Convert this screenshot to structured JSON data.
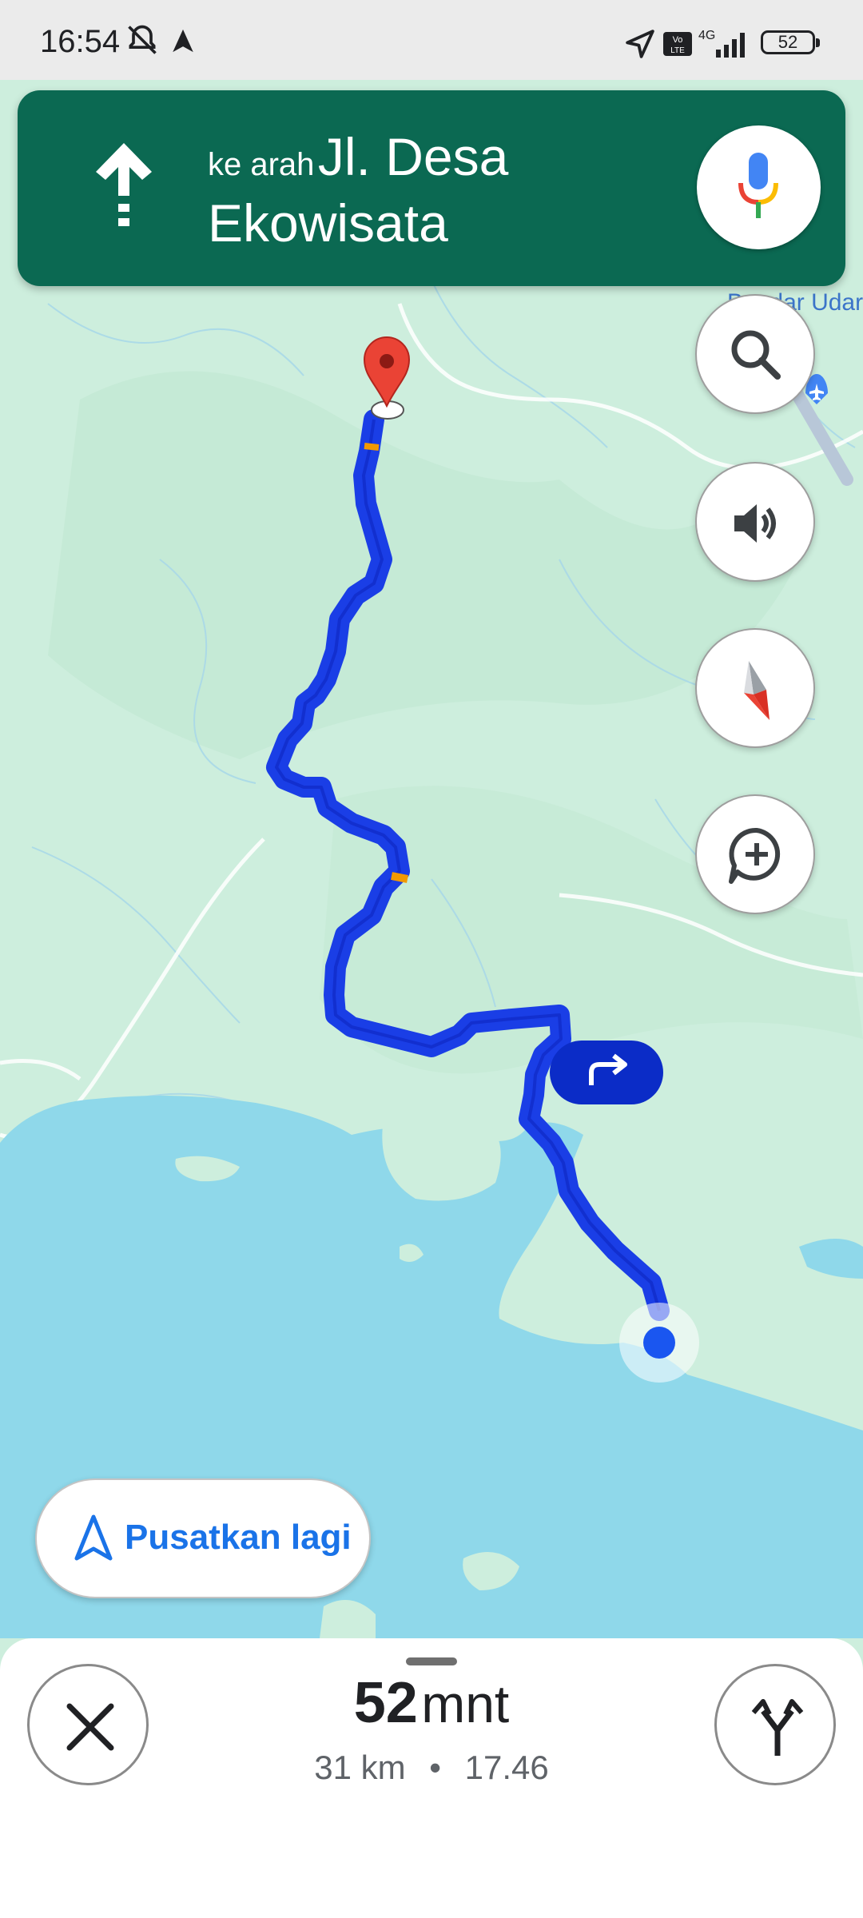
{
  "status_bar": {
    "time": "16:54",
    "battery": "52",
    "network": "4G"
  },
  "navigation": {
    "prefix": "ke arah",
    "street_line1": "Jl. Desa",
    "street_line2": "Ekowisata",
    "maneuver_icon": "straight-arrow-icon"
  },
  "map": {
    "label_airport": "Bandar Udara",
    "route_color": "#1a3ee6",
    "traffic_color": "#f29900",
    "destination_color": "#d93025",
    "land_color": "#cdeedd",
    "water_color": "#8fd8ea"
  },
  "controls": {
    "recenter_label": "Pusatkan lagi"
  },
  "trip": {
    "eta_number": "52",
    "eta_unit": "mnt",
    "distance": "31 km",
    "separator": "•",
    "arrival_time": "17.46"
  }
}
